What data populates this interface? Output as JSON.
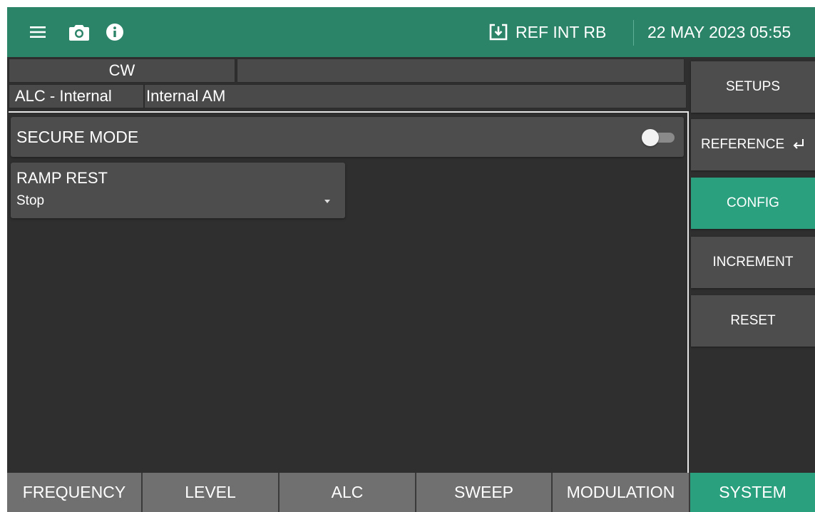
{
  "topbar": {
    "menu_icon": "hamburger-menu-icon",
    "camera_icon": "camera-icon",
    "info_icon": "info-icon",
    "reference_icon": "download-box-icon",
    "reference_text": "REF INT RB",
    "datetime": "22 MAY 2023 05:55"
  },
  "status": {
    "mode": "CW",
    "blank": "",
    "alc": "ALC - Internal",
    "modulation": "Internal AM"
  },
  "secure_mode": {
    "label": "SECURE MODE",
    "enabled": false
  },
  "ramp_rest": {
    "label": "RAMP REST",
    "value": "Stop"
  },
  "side_menu": {
    "setups": "SETUPS",
    "reference": "REFERENCE",
    "reference_icon": "enter-return-icon",
    "config": "CONFIG",
    "increment": "INCREMENT",
    "reset": "RESET",
    "active": "CONFIG"
  },
  "bottom_tabs": [
    "FREQUENCY",
    "LEVEL",
    "ALC",
    "SWEEP",
    "MODULATION",
    "SYSTEM"
  ],
  "active_tab": "SYSTEM",
  "colors": {
    "header": "#2b8468",
    "accent": "#2aa07f",
    "background": "#2f2f2f",
    "panel": "#4d4d4d",
    "tab": "#707070"
  }
}
